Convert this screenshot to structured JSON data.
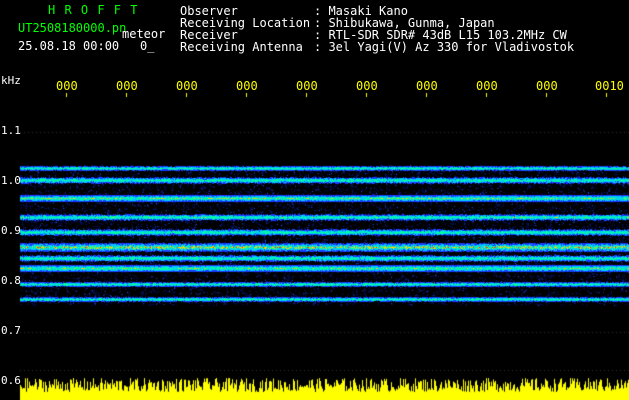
{
  "header": {
    "app_name": "H R O F F T",
    "file_name": "UT2508180000.pn",
    "mode": "meteor",
    "datetime": "25.08.18 00:00",
    "counter": "0_",
    "info_labels": [
      "Observer",
      "Receiving Location",
      "Receiver",
      "Receiving Antenna"
    ],
    "info_values": [
      ": Masaki Kano",
      ": Shibukawa, Gunma, Japan",
      ": RTL-SDR SDR# 43dB L15 103.2MHz CW",
      ": 3el Yagi(V) Az 330 for Vladivostok"
    ]
  },
  "axis": {
    "y_unit": "kHz",
    "y_ticks": [
      "1.1",
      "1.0",
      "0.9",
      "0.8",
      "0.7",
      "0.6"
    ],
    "x_ticks": [
      "000",
      "000",
      "000",
      "000",
      "000",
      "000",
      "000",
      "000",
      "000",
      "0010"
    ]
  },
  "colors": {
    "header_green": "#00ff00",
    "label_white": "#ffffff",
    "tick_yellow": "#ffff00",
    "background": "#000000",
    "band_blue": "#1a3cff",
    "band_hot": "#ff3000",
    "band_cyan": "#00e0ff"
  }
}
